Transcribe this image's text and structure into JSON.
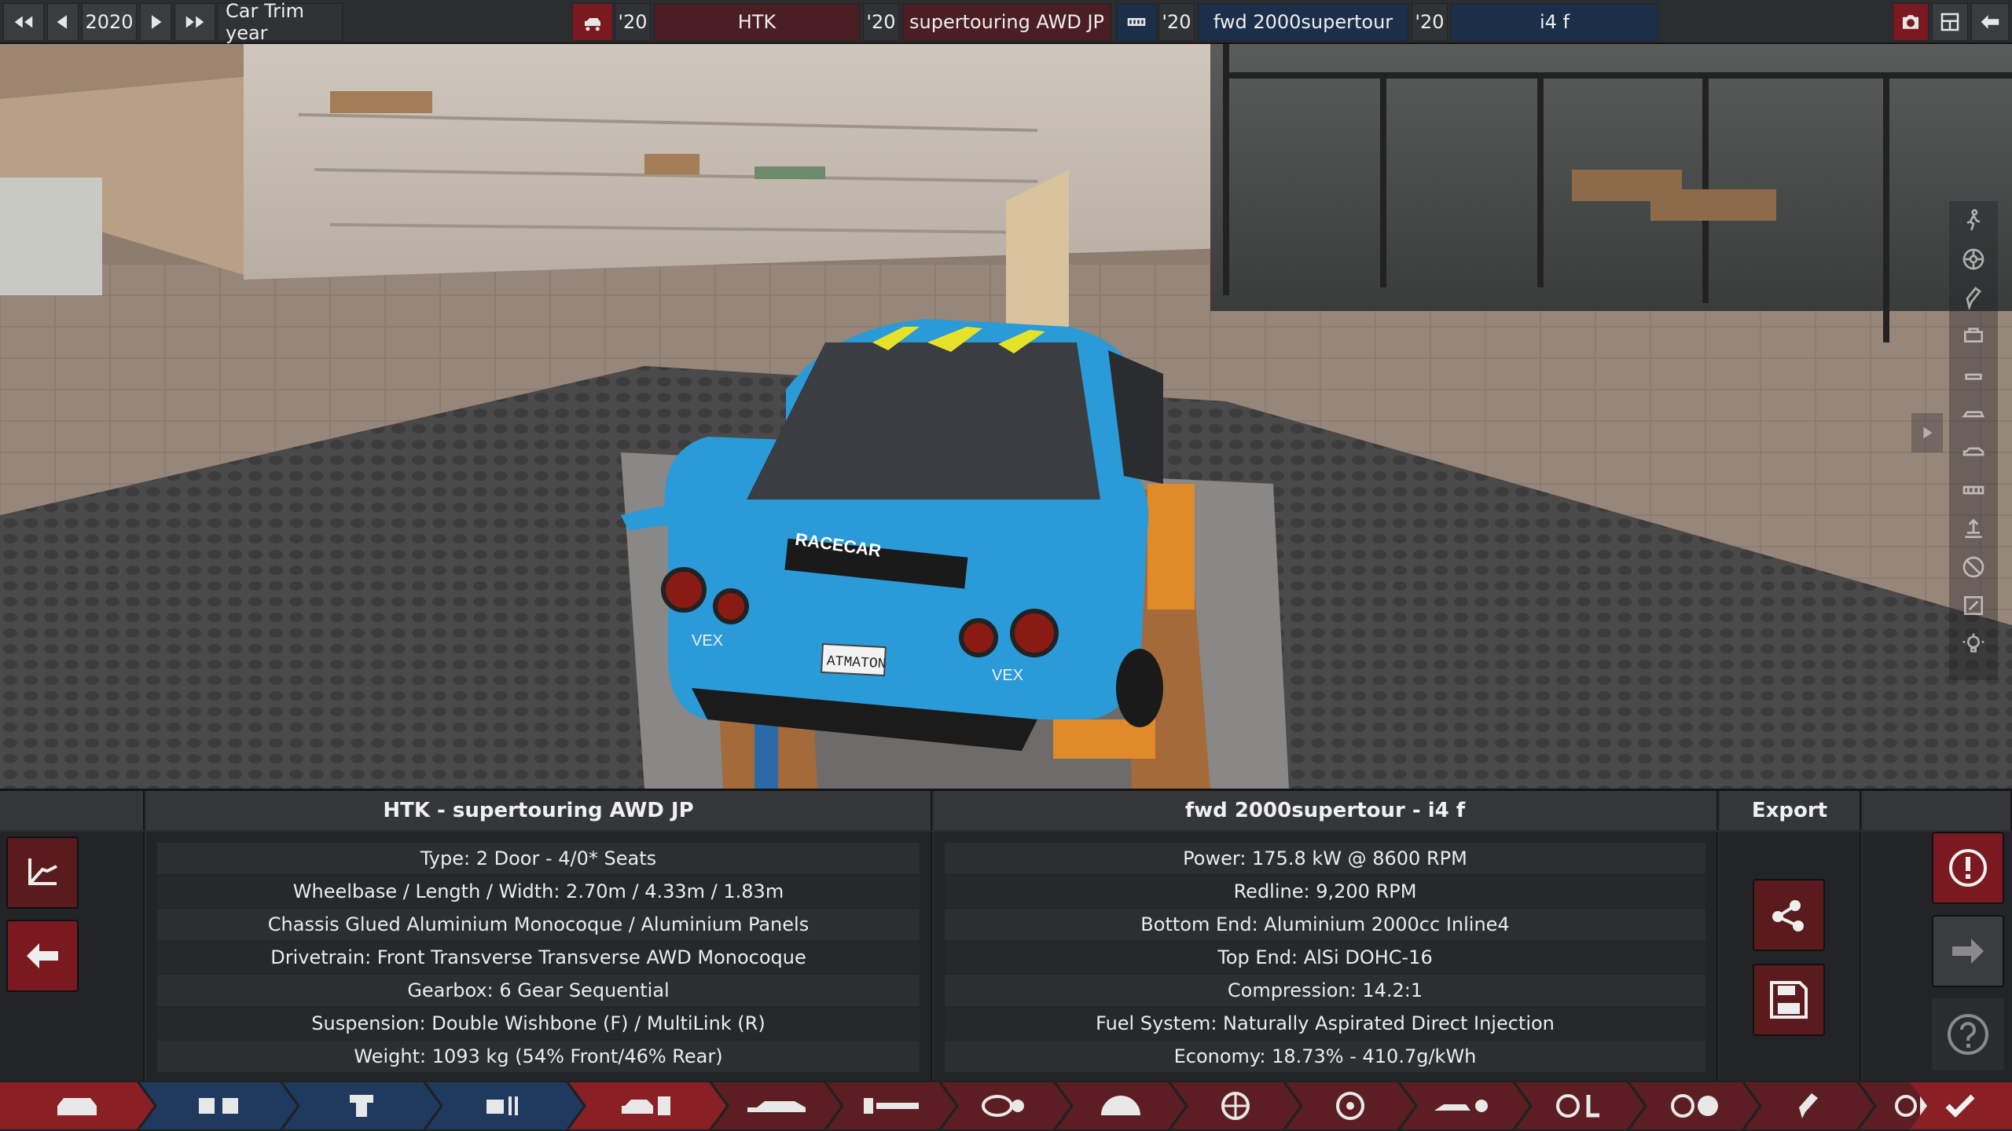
{
  "topbar": {
    "year": "2020",
    "car_trim_year_label": "Car Trim year",
    "model_year": "'20",
    "model_name": "HTK",
    "trim_year": "'20",
    "trim_name": "supertouring AWD JP",
    "engine_family_year": "'20",
    "engine_family_name": "fwd 2000supertour",
    "engine_variant_year": "'20",
    "engine_variant_name": "i4 f"
  },
  "car_panel": {
    "title": "HTK - supertouring AWD JP",
    "rows": [
      "Type: 2 Door - 4/0* Seats",
      "Wheelbase / Length / Width: 2.70m / 4.33m / 1.83m",
      "Chassis Glued Aluminium Monocoque / Aluminium Panels",
      "Drivetrain: Front Transverse Transverse AWD Monocoque",
      "Gearbox: 6 Gear Sequential",
      "Suspension: Double Wishbone (F) / MultiLink (R)",
      "Weight: 1093 kg (54% Front/46% Rear)"
    ]
  },
  "engine_panel": {
    "title": "fwd 2000supertour - i4 f",
    "rows": [
      "Power: 175.8 kW @ 8600 RPM",
      "Redline:  9,200 RPM",
      "Bottom End: Aluminium 2000cc Inline4",
      "Top End: AlSi DOHC-16",
      "Compression: 14.2:1",
      "Fuel System: Naturally Aspirated Direct Injection",
      "Economy: 18.73% - 410.7g/kWh"
    ]
  },
  "export_panel": {
    "title": "Export"
  },
  "scene": {
    "license_plate": "ATMATON",
    "wing_decal": "RACECAR",
    "sponsor_left": "VEX",
    "sponsor_right": "VEX"
  },
  "colors": {
    "accent_red": "#8a1f26",
    "accent_blue": "#1f3a5e",
    "car_body": "#2a9ad8",
    "decal_yellow": "#e6e22a"
  }
}
